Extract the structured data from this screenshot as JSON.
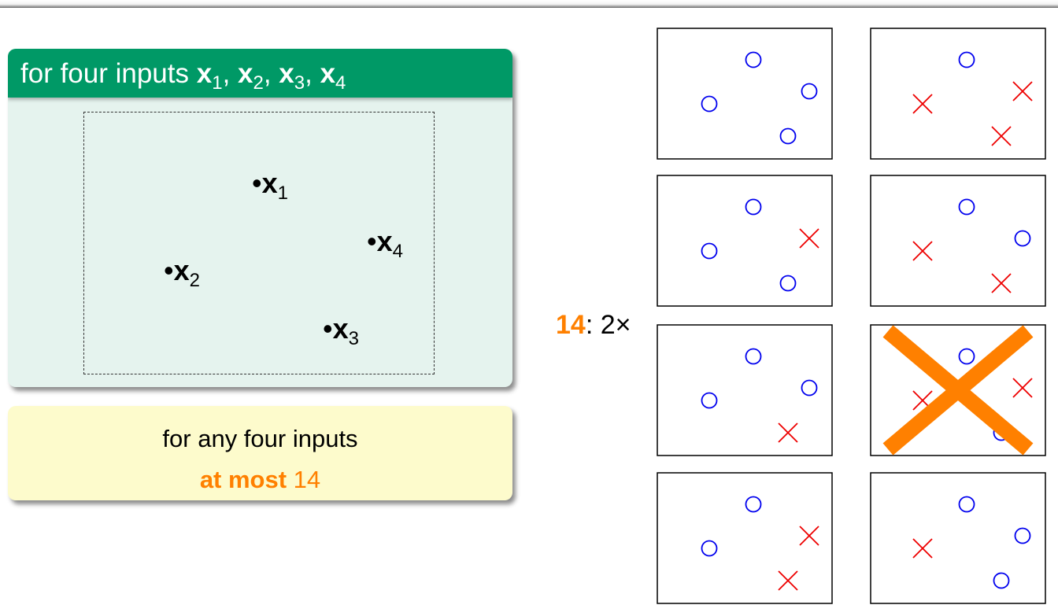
{
  "header": {
    "title_prefix": "for four inputs ",
    "inputs": [
      {
        "var": "x",
        "sub": "1",
        "sep": ", "
      },
      {
        "var": "x",
        "sub": "2",
        "sep": ", "
      },
      {
        "var": "x",
        "sub": "3",
        "sep": ", "
      },
      {
        "var": "x",
        "sub": "4",
        "sep": ""
      }
    ]
  },
  "points": [
    {
      "var": "x",
      "sub": "1"
    },
    {
      "var": "x",
      "sub": "2"
    },
    {
      "var": "x",
      "sub": "3"
    },
    {
      "var": "x",
      "sub": "4"
    }
  ],
  "bullet": "•",
  "summary": {
    "line1": "for any four inputs",
    "line2_bold": "at most",
    "line2_value": " 14"
  },
  "count": {
    "number": "14",
    "suffix": ": 2×"
  },
  "dichotomies": [
    {
      "row": 1,
      "col": 1,
      "labels": [
        "o",
        "o",
        "o",
        "o"
      ],
      "struck": false
    },
    {
      "row": 1,
      "col": 2,
      "labels": [
        "o",
        "x",
        "x",
        "x"
      ],
      "struck": false
    },
    {
      "row": 2,
      "col": 1,
      "labels": [
        "o",
        "o",
        "o",
        "x"
      ],
      "struck": false
    },
    {
      "row": 2,
      "col": 2,
      "labels": [
        "o",
        "x",
        "x",
        "o"
      ],
      "struck": false
    },
    {
      "row": 3,
      "col": 1,
      "labels": [
        "o",
        "o",
        "x",
        "o"
      ],
      "struck": false
    },
    {
      "row": 3,
      "col": 2,
      "labels": [
        "o",
        "x",
        "o",
        "x"
      ],
      "struck": true
    },
    {
      "row": 4,
      "col": 1,
      "labels": [
        "o",
        "o",
        "x",
        "x"
      ],
      "struck": false
    },
    {
      "row": 4,
      "col": 2,
      "labels": [
        "o",
        "x",
        "o",
        "o"
      ],
      "struck": false
    }
  ],
  "colors": {
    "circle": "#0000ee",
    "cross": "#ee0000",
    "strike": "#ff8000",
    "header_green": "#009966",
    "block_green": "#e5f3ee",
    "block_yellow": "#fdfbcc"
  }
}
